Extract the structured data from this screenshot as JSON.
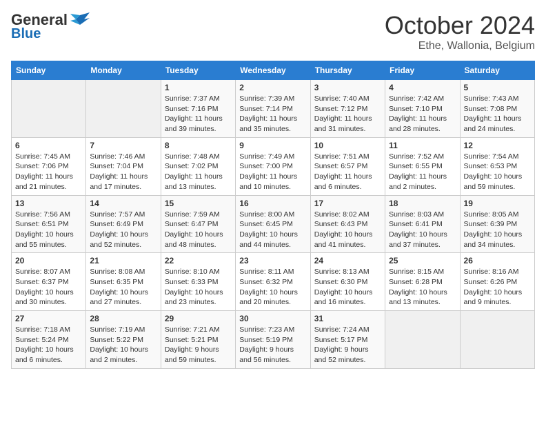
{
  "header": {
    "logo_general": "General",
    "logo_blue": "Blue",
    "title": "October 2024",
    "location": "Ethe, Wallonia, Belgium"
  },
  "columns": [
    "Sunday",
    "Monday",
    "Tuesday",
    "Wednesday",
    "Thursday",
    "Friday",
    "Saturday"
  ],
  "weeks": [
    [
      {
        "day": "",
        "info": ""
      },
      {
        "day": "",
        "info": ""
      },
      {
        "day": "1",
        "info": "Sunrise: 7:37 AM\nSunset: 7:16 PM\nDaylight: 11 hours and 39 minutes."
      },
      {
        "day": "2",
        "info": "Sunrise: 7:39 AM\nSunset: 7:14 PM\nDaylight: 11 hours and 35 minutes."
      },
      {
        "day": "3",
        "info": "Sunrise: 7:40 AM\nSunset: 7:12 PM\nDaylight: 11 hours and 31 minutes."
      },
      {
        "day": "4",
        "info": "Sunrise: 7:42 AM\nSunset: 7:10 PM\nDaylight: 11 hours and 28 minutes."
      },
      {
        "day": "5",
        "info": "Sunrise: 7:43 AM\nSunset: 7:08 PM\nDaylight: 11 hours and 24 minutes."
      }
    ],
    [
      {
        "day": "6",
        "info": "Sunrise: 7:45 AM\nSunset: 7:06 PM\nDaylight: 11 hours and 21 minutes."
      },
      {
        "day": "7",
        "info": "Sunrise: 7:46 AM\nSunset: 7:04 PM\nDaylight: 11 hours and 17 minutes."
      },
      {
        "day": "8",
        "info": "Sunrise: 7:48 AM\nSunset: 7:02 PM\nDaylight: 11 hours and 13 minutes."
      },
      {
        "day": "9",
        "info": "Sunrise: 7:49 AM\nSunset: 7:00 PM\nDaylight: 11 hours and 10 minutes."
      },
      {
        "day": "10",
        "info": "Sunrise: 7:51 AM\nSunset: 6:57 PM\nDaylight: 11 hours and 6 minutes."
      },
      {
        "day": "11",
        "info": "Sunrise: 7:52 AM\nSunset: 6:55 PM\nDaylight: 11 hours and 2 minutes."
      },
      {
        "day": "12",
        "info": "Sunrise: 7:54 AM\nSunset: 6:53 PM\nDaylight: 10 hours and 59 minutes."
      }
    ],
    [
      {
        "day": "13",
        "info": "Sunrise: 7:56 AM\nSunset: 6:51 PM\nDaylight: 10 hours and 55 minutes."
      },
      {
        "day": "14",
        "info": "Sunrise: 7:57 AM\nSunset: 6:49 PM\nDaylight: 10 hours and 52 minutes."
      },
      {
        "day": "15",
        "info": "Sunrise: 7:59 AM\nSunset: 6:47 PM\nDaylight: 10 hours and 48 minutes."
      },
      {
        "day": "16",
        "info": "Sunrise: 8:00 AM\nSunset: 6:45 PM\nDaylight: 10 hours and 44 minutes."
      },
      {
        "day": "17",
        "info": "Sunrise: 8:02 AM\nSunset: 6:43 PM\nDaylight: 10 hours and 41 minutes."
      },
      {
        "day": "18",
        "info": "Sunrise: 8:03 AM\nSunset: 6:41 PM\nDaylight: 10 hours and 37 minutes."
      },
      {
        "day": "19",
        "info": "Sunrise: 8:05 AM\nSunset: 6:39 PM\nDaylight: 10 hours and 34 minutes."
      }
    ],
    [
      {
        "day": "20",
        "info": "Sunrise: 8:07 AM\nSunset: 6:37 PM\nDaylight: 10 hours and 30 minutes."
      },
      {
        "day": "21",
        "info": "Sunrise: 8:08 AM\nSunset: 6:35 PM\nDaylight: 10 hours and 27 minutes."
      },
      {
        "day": "22",
        "info": "Sunrise: 8:10 AM\nSunset: 6:33 PM\nDaylight: 10 hours and 23 minutes."
      },
      {
        "day": "23",
        "info": "Sunrise: 8:11 AM\nSunset: 6:32 PM\nDaylight: 10 hours and 20 minutes."
      },
      {
        "day": "24",
        "info": "Sunrise: 8:13 AM\nSunset: 6:30 PM\nDaylight: 10 hours and 16 minutes."
      },
      {
        "day": "25",
        "info": "Sunrise: 8:15 AM\nSunset: 6:28 PM\nDaylight: 10 hours and 13 minutes."
      },
      {
        "day": "26",
        "info": "Sunrise: 8:16 AM\nSunset: 6:26 PM\nDaylight: 10 hours and 9 minutes."
      }
    ],
    [
      {
        "day": "27",
        "info": "Sunrise: 7:18 AM\nSunset: 5:24 PM\nDaylight: 10 hours and 6 minutes."
      },
      {
        "day": "28",
        "info": "Sunrise: 7:19 AM\nSunset: 5:22 PM\nDaylight: 10 hours and 2 minutes."
      },
      {
        "day": "29",
        "info": "Sunrise: 7:21 AM\nSunset: 5:21 PM\nDaylight: 9 hours and 59 minutes."
      },
      {
        "day": "30",
        "info": "Sunrise: 7:23 AM\nSunset: 5:19 PM\nDaylight: 9 hours and 56 minutes."
      },
      {
        "day": "31",
        "info": "Sunrise: 7:24 AM\nSunset: 5:17 PM\nDaylight: 9 hours and 52 minutes."
      },
      {
        "day": "",
        "info": ""
      },
      {
        "day": "",
        "info": ""
      }
    ]
  ]
}
